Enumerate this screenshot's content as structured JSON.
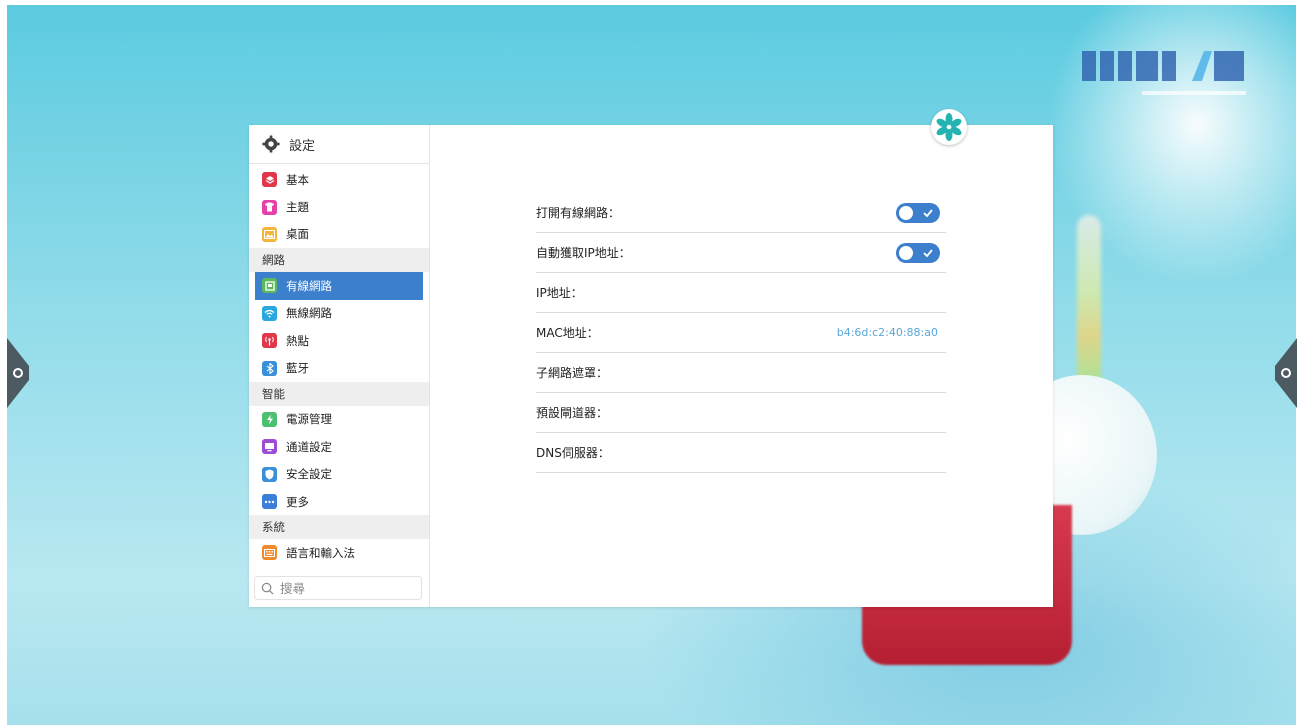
{
  "sidebar": {
    "title": "設定",
    "groups": [
      {
        "items": [
          {
            "label": "基本",
            "icon": "layers-icon",
            "color": "#e0384a"
          },
          {
            "label": "主題",
            "icon": "shirt-icon",
            "color": "#e63fa8"
          },
          {
            "label": "桌面",
            "icon": "picture-icon",
            "color": "#f4b63a"
          }
        ]
      },
      {
        "section": "網路",
        "items": [
          {
            "label": "有線網路",
            "icon": "ethernet-icon",
            "color": "#5cb85c",
            "active": true
          },
          {
            "label": "無線網路",
            "icon": "wifi-icon",
            "color": "#29a7de"
          },
          {
            "label": "熱點",
            "icon": "hotspot-icon",
            "color": "#e0384a"
          },
          {
            "label": "藍牙",
            "icon": "bluetooth-icon",
            "color": "#3b8fd8"
          }
        ]
      },
      {
        "section": "智能",
        "items": [
          {
            "label": "電源管理",
            "icon": "power-icon",
            "color": "#4cc070"
          },
          {
            "label": "通道設定",
            "icon": "channel-icon",
            "color": "#9b4dd6"
          },
          {
            "label": "安全設定",
            "icon": "shield-icon",
            "color": "#3b8fd8"
          },
          {
            "label": "更多",
            "icon": "more-icon",
            "color": "#3b7fd8"
          }
        ]
      },
      {
        "section": "系統",
        "items": [
          {
            "label": "語言和輸入法",
            "icon": "keyboard-icon",
            "color": "#f08a2b"
          }
        ]
      }
    ],
    "search_placeholder": "搜尋"
  },
  "wired": {
    "rows": [
      {
        "label": "打開有線網路：",
        "type": "toggle",
        "on": true
      },
      {
        "label": "自動獲取IP地址：",
        "type": "toggle",
        "on": true
      },
      {
        "label": "IP地址：",
        "type": "value",
        "value": ""
      },
      {
        "label": "MAC地址：",
        "type": "value",
        "value": "b4:6d:c2:40:88:a0"
      },
      {
        "label": "子網路遮罩：",
        "type": "value",
        "value": ""
      },
      {
        "label": "預設閘道器：",
        "type": "value",
        "value": ""
      },
      {
        "label": "DNS伺服器：",
        "type": "value",
        "value": ""
      }
    ]
  },
  "colors": {
    "accent": "#3c7fcc",
    "mac_value": "#5aa7d8"
  }
}
